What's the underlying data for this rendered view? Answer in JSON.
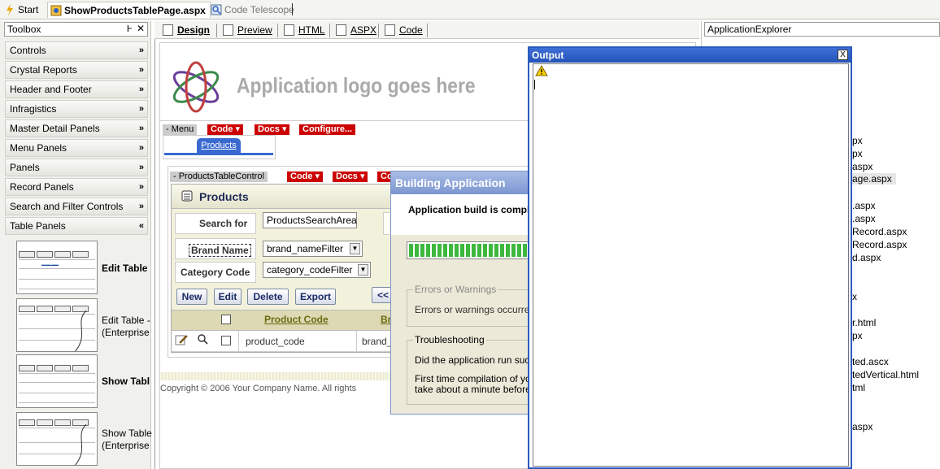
{
  "top_tabs": {
    "start": "Start",
    "active_file": "ShowProductsTablePage.aspx",
    "telescope": "Code Telescope"
  },
  "toolbox": {
    "title": "Toolbox",
    "pin": "Ͱ",
    "close": "✕",
    "categories": [
      "Controls",
      "Crystal Reports",
      "Header and Footer",
      "Infragistics",
      "Master Detail Panels",
      "Menu Panels",
      "Panels",
      "Record Panels",
      "Search and Filter Controls",
      "Table Panels"
    ],
    "chev_collapsed": "»",
    "chev_expanded": "«",
    "items": [
      {
        "label": "Edit Table",
        "bold": true
      },
      {
        "label_line1": "Edit Table -",
        "label_line2": "(Enterprise"
      },
      {
        "label": "Show Tabl",
        "bold": true
      },
      {
        "label_line1": "Show Table",
        "label_line2": "(Enterprise"
      }
    ]
  },
  "view_tabs": [
    "Design",
    "Preview",
    "HTML",
    "ASPX",
    "Code"
  ],
  "design": {
    "logo_text": "Application logo goes here",
    "menu": {
      "label": "- Menu",
      "items": [
        "Code ▾",
        "Docs ▾",
        "Configure..."
      ]
    },
    "products_tab": "Products",
    "control": {
      "label": "- ProductsTableControl",
      "items": [
        "Code ▾",
        "Docs ▾",
        "Co"
      ]
    },
    "panel_title": "Products",
    "search_for": "Search for",
    "search_field": "ProductsSearchArea",
    "brand_name": "Brand Name",
    "brand_filter": "brand_nameFilter",
    "category_code": "Category Code",
    "category_filter": "category_codeFilter",
    "buttons": [
      "New",
      "Edit",
      "Delete",
      "Export"
    ],
    "prev": "<<",
    "col_product_code": "Product Code",
    "col_brand": "Br",
    "cell_product_code": "product_code",
    "cell_brand": "brand_",
    "copyright": "Copyright © 2006 Your Company Name. All rights"
  },
  "dialog": {
    "title": "Building Application",
    "status": "Application build is complet",
    "errors_group": "Errors or Warnings",
    "errors_text": "Errors or warnings occurred",
    "trouble_group": "Troubleshooting",
    "trouble_q": "Did the application run succ",
    "trouble_l1": "First time compilation of you",
    "trouble_l2": "take about a minute before y",
    "progress": 1.0
  },
  "output": {
    "title": "Output",
    "close": "X"
  },
  "app_explorer": {
    "title": "ApplicationExplorer",
    "items": [
      "px",
      "px",
      "aspx",
      "age.aspx",
      ".aspx",
      ".aspx",
      "Record.aspx",
      "Record.aspx",
      "d.aspx",
      "x",
      "r.html",
      "px",
      "ted.ascx",
      "tedVertical.html",
      "tml",
      "aspx"
    ]
  }
}
